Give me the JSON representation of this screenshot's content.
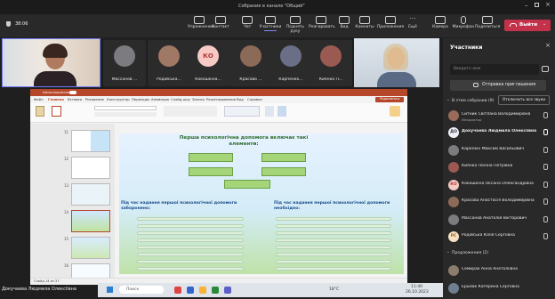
{
  "window": {
    "title": "Собрание в канале \"Общий\"",
    "timer": "38:06"
  },
  "toolbar": {
    "items": [
      "Упражнения",
      "Контакт",
      "Чат",
      "Участники",
      "Поднять руку",
      "Реагировать",
      "Вид",
      "Комнаты",
      "Приложения",
      "Ещё",
      "Камера",
      "Микрофон",
      "Поделиться"
    ],
    "leave_label": "Выйти"
  },
  "tiles": [
    {
      "name": "Массанов ..."
    },
    {
      "name": "Родійська..."
    },
    {
      "name": "Кокошкіна...",
      "initials": "КО"
    },
    {
      "name": "Красова ..."
    },
    {
      "name": "Карпенко..."
    },
    {
      "name": "Киянка П..."
    }
  ],
  "presenter": {
    "name": "Докучаева Людмила Олексіївна"
  },
  "ppt": {
    "autosave": "Автосохранение",
    "ribbon_tabs": [
      "Файл",
      "Главная",
      "Вставка",
      "Рисование",
      "Конструктор",
      "Переходы",
      "Анимация",
      "Слайд-шоу",
      "Запись",
      "Рецензирование",
      "Вид",
      "Справка"
    ],
    "share_label": "Поделиться",
    "slide_title": "Перша психологічна допомога включає такі елементи:",
    "left_heading": "Під час надання першої психологічної допомоги заборонено:",
    "right_heading": "Під час надання першої психологічної допомоги необхідно:",
    "thumb_numbers": [
      "11",
      "12",
      "13",
      "14",
      "15",
      "16",
      "17"
    ],
    "statusbar": "Слайд 14 из 27"
  },
  "taskbar": {
    "search": "Поиск",
    "temp": "18°C",
    "time": "11:40",
    "date": "26.10.2023"
  },
  "participants": {
    "title": "Участники",
    "search_placeholder": "Введите имя",
    "invite_label": "Отправка приглашения",
    "in_meeting_label": "В этом собрании (9)",
    "mute_all_label": "Отключить все звуки",
    "members": [
      {
        "name": "Ситник Світлана Володимирівна",
        "sub": "Инициатор",
        "initials": ""
      },
      {
        "name": "Докучаева Людмила Олексіївна",
        "sub": "",
        "initials": "ДО"
      },
      {
        "name": "Карелкін Максим Васильович",
        "sub": "",
        "initials": ""
      },
      {
        "name": "Киянка Поліна Петрівна",
        "sub": "",
        "initials": ""
      },
      {
        "name": "Кокошкіна Оксана Олександрівна",
        "sub": "",
        "initials": "КО"
      },
      {
        "name": "Красова Анастасія Володимирівна",
        "sub": "",
        "initials": ""
      },
      {
        "name": "Массанов Анатолій Вікторович",
        "sub": "",
        "initials": ""
      },
      {
        "name": "Родійська Юлія Сергіївна",
        "sub": "",
        "initials": "РС"
      }
    ],
    "suggested_label": "Предложения (2)",
    "suggested": [
      {
        "name": "Семирак Анна Анатоліївна"
      },
      {
        "name": "Ерьмак Катерина Сергіївна"
      }
    ]
  }
}
